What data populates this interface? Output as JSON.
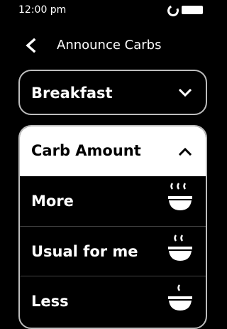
{
  "status": {
    "time": "12:00 pm",
    "icons": [
      "ring-icon",
      "battery-icon"
    ]
  },
  "header": {
    "back_icon": "chevron-left-icon",
    "title": "Announce Carbs"
  },
  "meal": {
    "selected": "Breakfast",
    "icon": "chevron-down-icon"
  },
  "carb_amount": {
    "label": "Carb Amount",
    "icon": "chevron-up-icon",
    "options": [
      {
        "label": "More",
        "icon": "bowl-steam-3-icon"
      },
      {
        "label": "Usual for me",
        "icon": "bowl-steam-2-icon"
      },
      {
        "label": "Less",
        "icon": "bowl-steam-1-icon"
      }
    ]
  },
  "colors": {
    "background": "#000000",
    "text": "#ffffff",
    "border": "#bdbdbd",
    "selected_header": "#ffffff"
  }
}
